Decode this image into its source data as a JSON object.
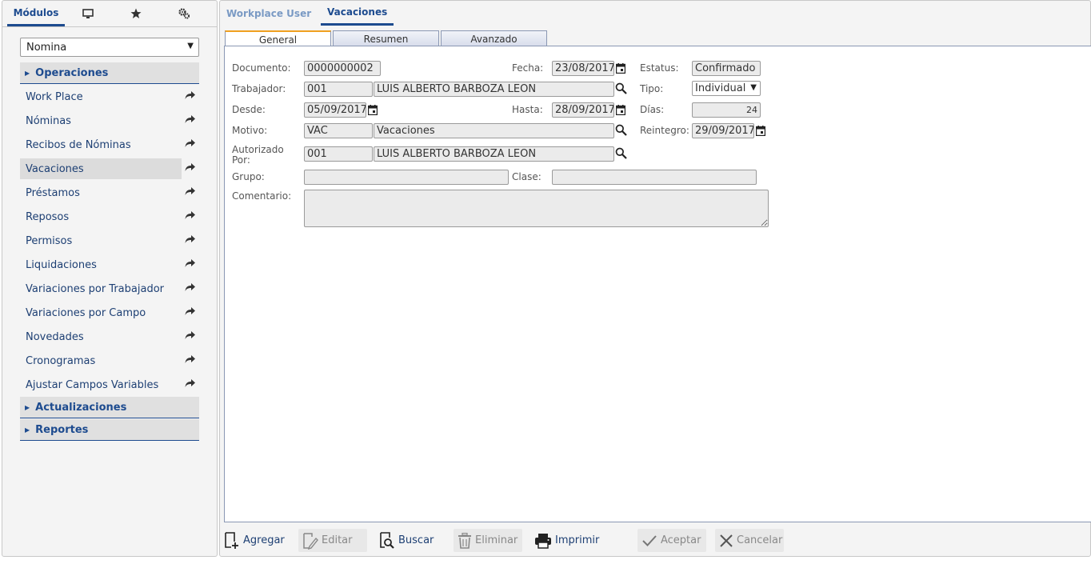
{
  "left_panel": {
    "tabs": {
      "modulos": "Módulos"
    },
    "module_select": "Nomina",
    "sections": {
      "operaciones": "Operaciones",
      "actualizaciones": "Actualizaciones",
      "reportes": "Reportes"
    },
    "items": [
      {
        "label": "Work Place"
      },
      {
        "label": "Nóminas"
      },
      {
        "label": "Recibos de Nóminas"
      },
      {
        "label": "Vacaciones"
      },
      {
        "label": "Préstamos"
      },
      {
        "label": "Reposos"
      },
      {
        "label": "Permisos"
      },
      {
        "label": "Liquidaciones"
      },
      {
        "label": "Variaciones por Trabajador"
      },
      {
        "label": "Variaciones por Campo"
      },
      {
        "label": "Novedades"
      },
      {
        "label": "Cronogramas"
      },
      {
        "label": "Ajustar Campos Variables"
      }
    ]
  },
  "right_panel": {
    "tabs": {
      "workplace": "Workplace User",
      "vacaciones": "Vacaciones"
    },
    "form_tabs": {
      "general": "General",
      "resumen": "Resumen",
      "avanzado": "Avanzado"
    }
  },
  "form": {
    "labels": {
      "documento": "Documento:",
      "fecha": "Fecha:",
      "estatus": "Estatus:",
      "trabajador": "Trabajador:",
      "tipo": "Tipo:",
      "desde": "Desde:",
      "hasta": "Hasta:",
      "dias": "Días:",
      "motivo": "Motivo:",
      "reintegro": "Reintegro:",
      "autorizado_1": "Autorizado",
      "autorizado_2": "Por:",
      "grupo": "Grupo:",
      "clase": "Clase:",
      "comentario": "Comentario:"
    },
    "values": {
      "documento": "0000000002",
      "fecha": "23/08/2017",
      "estatus": "Confirmado",
      "trabajador_code": "001",
      "trabajador_name": "LUIS ALBERTO BARBOZA LEON",
      "tipo": "Individual",
      "desde": "05/09/2017",
      "hasta": "28/09/2017",
      "dias": "24",
      "motivo_code": "VAC",
      "motivo_name": "Vacaciones",
      "reintegro": "29/09/2017",
      "autorizado_code": "001",
      "autorizado_name": "LUIS ALBERTO BARBOZA LEON",
      "grupo": "",
      "clase": "",
      "comentario": ""
    }
  },
  "toolbar": {
    "agregar": "Agregar",
    "editar": "Editar",
    "buscar": "Buscar",
    "eliminar": "Eliminar",
    "imprimir": "Imprimir",
    "aceptar": "Aceptar",
    "cancelar": "Cancelar"
  },
  "colors": {
    "accent": "#1d4b8f",
    "active_tab_top": "#f0a020",
    "panel_bg": "#f4f4f4"
  },
  "icons": [
    "monitor-icon",
    "star-icon",
    "gears-icon",
    "share-arrow-icon",
    "search-icon",
    "calendar-icon",
    "add-document-icon",
    "edit-icon",
    "search-document-icon",
    "trash-icon",
    "printer-icon",
    "check-icon",
    "close-icon"
  ]
}
